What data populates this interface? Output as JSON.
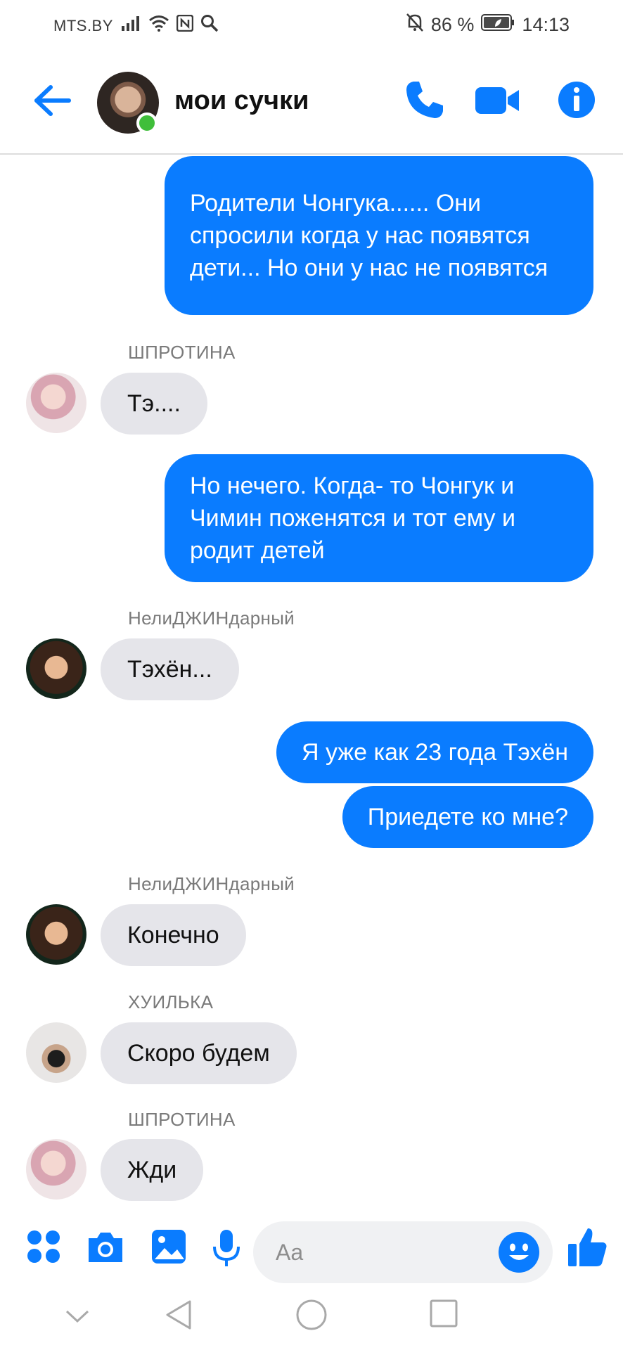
{
  "status_bar": {
    "carrier": "MTS.BY",
    "battery": "86 %",
    "time": "14:13"
  },
  "header": {
    "title": "мои сучки",
    "online": true
  },
  "messages": [
    {
      "direction": "out",
      "text": "Родители Чонгука...... Они спросили когда у нас появятся дети... Но они у нас не появятся"
    },
    {
      "direction": "in",
      "sender": "ШПРОТИНА",
      "text": "Тэ...."
    },
    {
      "direction": "out",
      "text": "Но нечего. Когда- то Чонгук и Чимин поженятся и тот ему и родит детей"
    },
    {
      "direction": "in",
      "sender": "НелиДЖИНдарный",
      "text": "Тэхён..."
    },
    {
      "direction": "out",
      "text": "Я уже как 23 года Тэхён"
    },
    {
      "direction": "out",
      "text": "Приедете ко мне?"
    },
    {
      "direction": "in",
      "sender": "НелиДЖИНдарный",
      "text": "Конечно"
    },
    {
      "direction": "in",
      "sender": "ХУИЛЬКА",
      "text": "Скоро будем"
    },
    {
      "direction": "in",
      "sender": "ШПРОТИНА",
      "text": "Жди"
    }
  ],
  "composer": {
    "placeholder": "Aa"
  },
  "colors": {
    "accent": "#0a7cff",
    "incoming_bubble": "#e5e5ea",
    "online": "#3fbe3a"
  },
  "icons": [
    "back-arrow-icon",
    "phone-icon",
    "video-camera-icon",
    "info-icon",
    "apps-grid-icon",
    "camera-icon",
    "gallery-icon",
    "microphone-icon",
    "emoji-icon",
    "thumbs-up-icon",
    "nav-back-icon",
    "nav-home-icon",
    "nav-recents-icon",
    "nav-collapse-icon"
  ]
}
